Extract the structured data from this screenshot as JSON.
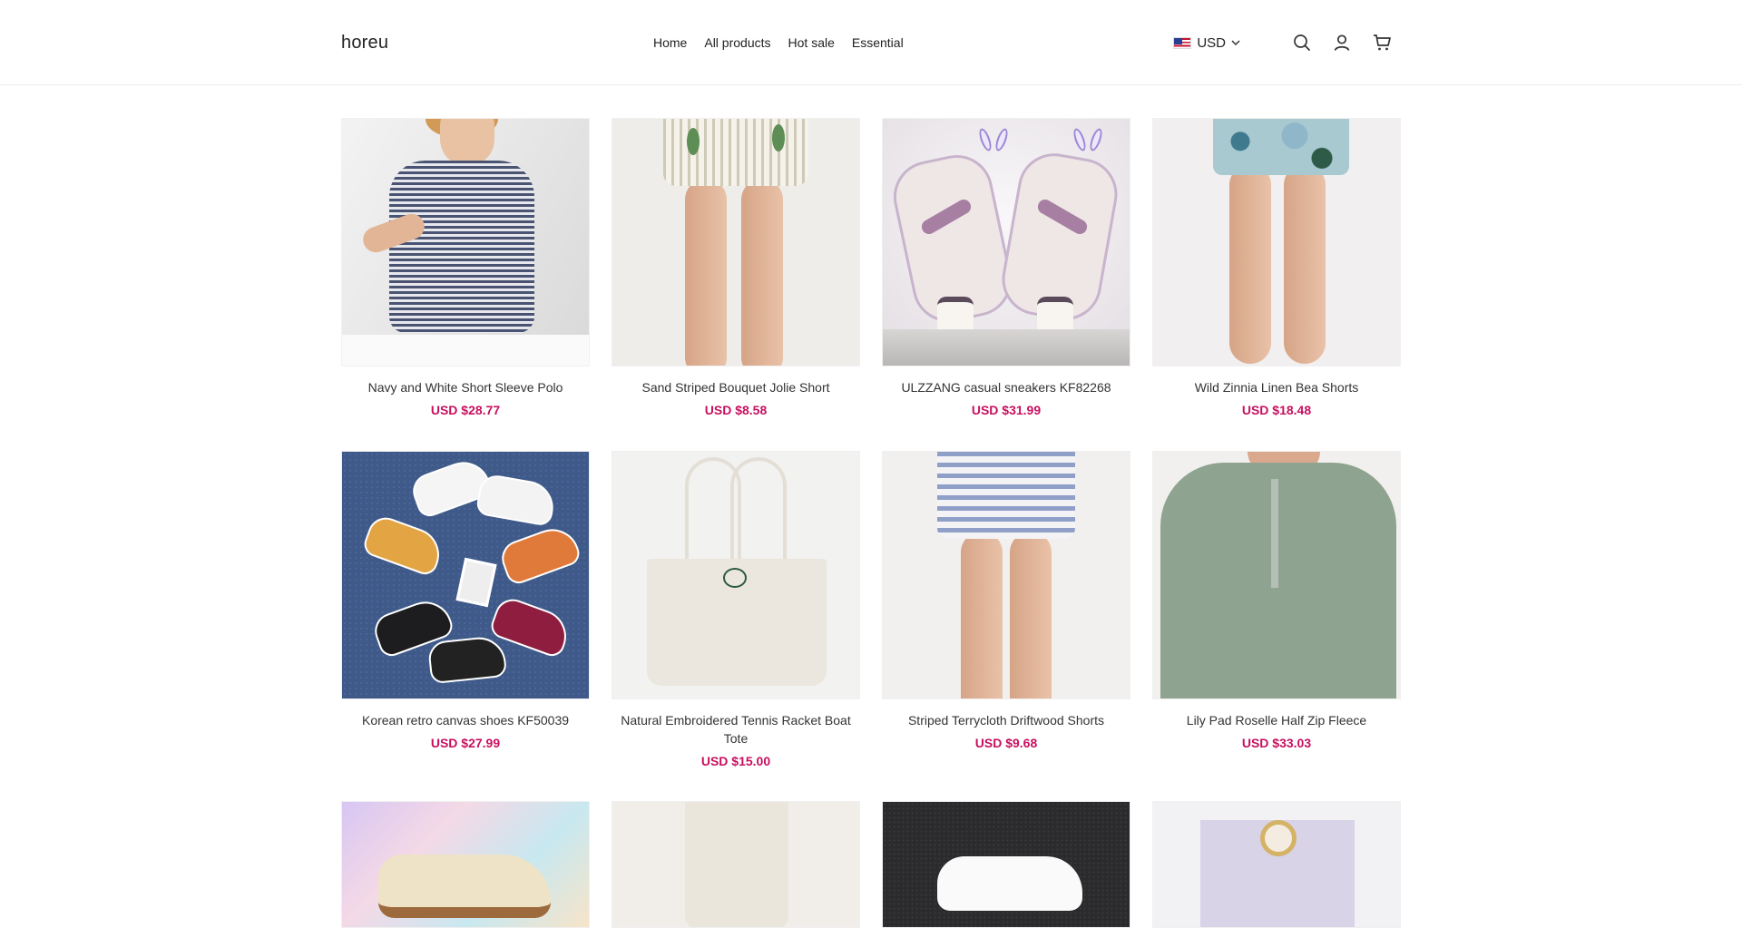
{
  "brand": {
    "logo": "horeu"
  },
  "nav": [
    {
      "label": "Home"
    },
    {
      "label": "All products"
    },
    {
      "label": "Hot sale"
    },
    {
      "label": "Essential"
    }
  ],
  "currency": {
    "label": "USD",
    "flag": "us-flag-icon"
  },
  "icons": {
    "search": "search-icon",
    "account": "user-icon",
    "cart": "cart-icon"
  },
  "colors": {
    "price": "#c7105f",
    "text": "#333333"
  },
  "products": [
    {
      "title": "Navy and White Short Sleeve Polo",
      "price": "USD $28.77"
    },
    {
      "title": "Sand Striped Bouquet Jolie Short",
      "price": "USD $8.58"
    },
    {
      "title": "ULZZANG casual sneakers KF82268",
      "price": "USD $31.99"
    },
    {
      "title": "Wild Zinnia Linen Bea Shorts",
      "price": "USD $18.48"
    },
    {
      "title": "Korean retro canvas shoes KF50039",
      "price": "USD $27.99"
    },
    {
      "title": "Natural Embroidered Tennis Racket Boat Tote",
      "price": "USD $15.00"
    },
    {
      "title": "Striped Terrycloth Driftwood Shorts",
      "price": "USD $9.68"
    },
    {
      "title": "Lily Pad Roselle Half Zip Fleece",
      "price": "USD $33.03"
    }
  ]
}
